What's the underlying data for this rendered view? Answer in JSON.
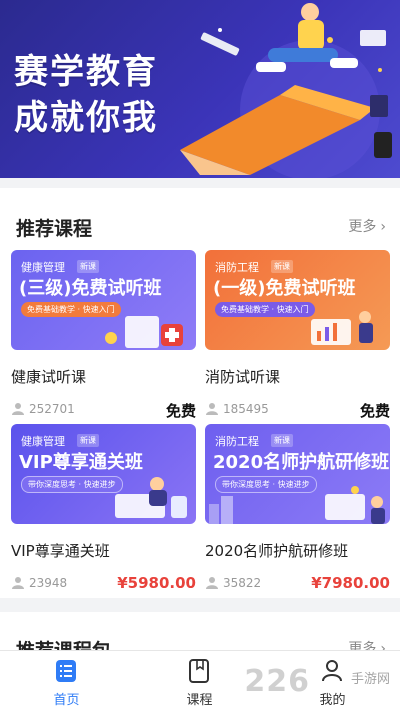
{
  "banner": {
    "line1": "赛学教育",
    "line2": "成就你我"
  },
  "section1": {
    "title": "推荐课程",
    "more": "更多"
  },
  "courses": [
    {
      "category": "健康管理",
      "badge": "新课",
      "headline": "(三级)免费试听班",
      "tagline": "免费基础教学 · 快速入门",
      "name": "健康试听课",
      "count": "252701",
      "price": "免费"
    },
    {
      "category": "消防工程",
      "badge": "新课",
      "headline": "(一级)免费试听班",
      "tagline": "免费基础教学 · 快速入门",
      "name": "消防试听课",
      "count": "185495",
      "price": "免费"
    },
    {
      "category": "健康管理",
      "badge": "新课",
      "headline": "VIP尊享通关班",
      "tagline": "带你深度思考 · 快速进步",
      "name": "VIP尊享通关班",
      "count": "23948",
      "price": "¥5980.00"
    },
    {
      "category": "消防工程",
      "badge": "新课",
      "headline": "2020名师护航研修班",
      "tagline": "带你深度思考 · 快速进步",
      "name": "2020名师护航研修班",
      "count": "35822",
      "price": "¥7980.00"
    }
  ],
  "section2": {
    "title": "推荐课程包",
    "more": "更多"
  },
  "tabs": [
    {
      "label": "首页",
      "icon": "home-list-icon",
      "active": true
    },
    {
      "label": "课程",
      "icon": "book-icon",
      "active": false
    },
    {
      "label": "我的",
      "icon": "user-icon",
      "active": false
    }
  ],
  "watermark": {
    "text": "226",
    "sub": "手游网"
  },
  "colors": {
    "accent": "#2f7cf6",
    "price": "#e8423b",
    "banner": "#3b34b8"
  }
}
